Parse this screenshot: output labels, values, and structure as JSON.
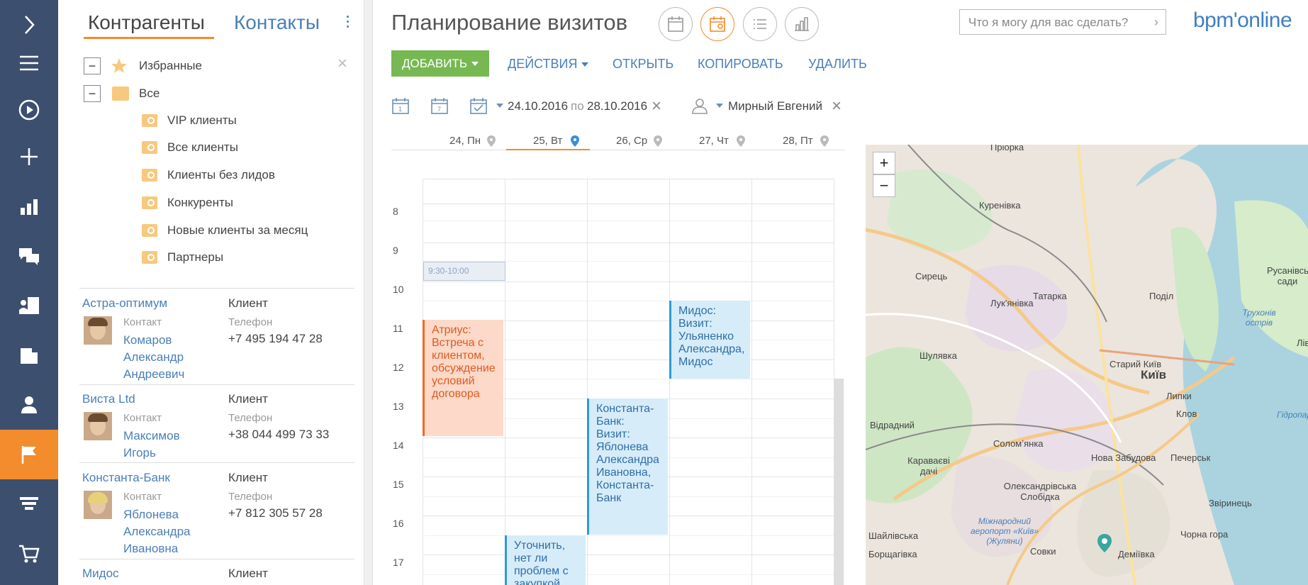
{
  "left_panel": {
    "tab_accounts": "Контрагенты",
    "tab_contacts": "Контакты",
    "folders": {
      "favorites": "Избранные",
      "all": "Все",
      "items": [
        "VIP клиенты",
        "Все клиенты",
        "Клиенты без лидов",
        "Конкуренты",
        "Новые клиенты за месяц",
        "Партнеры"
      ]
    },
    "contacts": [
      {
        "name": "Астра-оптимум",
        "type": "Клиент",
        "contact_label": "Контакт",
        "phone_label": "Телефон",
        "person": "Комаров Александр Андреевич",
        "phone": "+7 495 194 47 28"
      },
      {
        "name": "Виста Ltd",
        "type": "Клиент",
        "contact_label": "Контакт",
        "phone_label": "Телефон",
        "person": "Максимов Игорь",
        "phone": "+38 044 499 73 33"
      },
      {
        "name": "Константа-Банк",
        "type": "Клиент",
        "contact_label": "Контакт",
        "phone_label": "Телефон",
        "person": "Яблонева Александра Ивановна",
        "phone": "+7 812 305 57 28"
      },
      {
        "name": "Мидос",
        "type": "Клиент"
      }
    ]
  },
  "header": {
    "title": "Планирование визитов",
    "search_placeholder": "Что я могу для вас сделать?",
    "logo": "bpm'online"
  },
  "toolbar": {
    "add": "ДОБАВИТЬ",
    "actions": "ДЕЙСТВИЯ",
    "open": "ОТКРЫТЬ",
    "copy": "КОПИРОВАТЬ",
    "delete": "УДАЛИТЬ"
  },
  "filters": {
    "date_from": "24.10.2016",
    "date_sep": "по",
    "date_to": "28.10.2016",
    "owner": "Мирный Евгений",
    "calendar_day_icon_digit": "1",
    "calendar_week_icon_digit": "7"
  },
  "calendar": {
    "days": [
      "24, Пн",
      "25, Вт",
      "26, Ср",
      "27, Чт",
      "28, Пт"
    ],
    "active_day_index": 1,
    "hours": [
      "8",
      "9",
      "10",
      "11",
      "12",
      "13",
      "14",
      "15",
      "16",
      "17"
    ],
    "selected_slot": "9:30-10:00",
    "events": [
      {
        "text": "Атриус: Встреча с клиентом, обсуждение условий договора",
        "color": "orange"
      },
      {
        "text": "Мидос: Визит: Ульяненко Александра, Мидос",
        "color": "blue"
      },
      {
        "text": "Константа-Банк: Визит: Яблонева Александра Ивановна, Константа-Банк",
        "color": "blue"
      },
      {
        "text": "Уточнить, нет ли проблем с закупкой",
        "color": "blue"
      }
    ]
  },
  "map": {
    "zoom_in": "+",
    "zoom_out": "−",
    "labels": [
      "Пріорка",
      "Куренівка",
      "Сирець",
      "Татарка",
      "Поділ",
      "Лук'янівка",
      "Русанівські сади",
      "Трухонів острів",
      "Шулявка",
      "Старий Київ",
      "Київ",
      "Лівобережна",
      "Липки",
      "Клов",
      "Відрадний",
      "Соломʼянка",
      "Гідропарк",
      "Караваєві дачі",
      "Нова Забудова",
      "Печерськ",
      "Олександрівська Слобідка",
      "Звіринець",
      "Міжнародний аеропорт «Київ» (Жуляни)",
      "Чорна гора",
      "Деміївка",
      "Совки",
      "Шайлівська",
      "Борщагівка"
    ]
  },
  "colors": {
    "rail": "#3d4f6e",
    "accent_orange": "#f28c2c",
    "link_blue": "#4a7fb8",
    "add_green": "#76b852"
  }
}
